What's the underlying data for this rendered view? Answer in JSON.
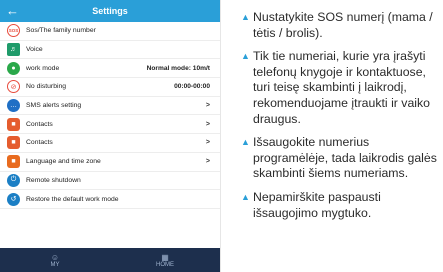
{
  "header": {
    "back_icon": "arrow-left-icon",
    "title": "Settings"
  },
  "settings": [
    {
      "name": "sos-family-number",
      "icon": "sos-icon",
      "icon_text": "SOS",
      "label": "Sos/The family number",
      "value": "",
      "chevron": ""
    },
    {
      "name": "voice",
      "icon": "trumpet-icon",
      "icon_text": "",
      "label": "Voice",
      "value": "",
      "chevron": ""
    },
    {
      "name": "work-mode",
      "icon": "work-mode-icon",
      "icon_text": "",
      "label": "work mode",
      "value": "Normal mode: 10m/t",
      "chevron": ""
    },
    {
      "name": "no-disturbing",
      "icon": "do-not-disturb-icon",
      "icon_text": "",
      "label": "No disturbing",
      "value": "00:00-00:00",
      "chevron": ""
    },
    {
      "name": "sms-alerts",
      "icon": "chat-bubble-icon",
      "icon_text": "",
      "label": "SMS alerts setting",
      "value": "",
      "chevron": ">"
    },
    {
      "name": "contacts-1",
      "icon": "contacts-icon",
      "icon_text": "",
      "label": "Contacts",
      "value": "",
      "chevron": ">"
    },
    {
      "name": "contacts-2",
      "icon": "contacts-icon",
      "icon_text": "",
      "label": "Contacts",
      "value": "",
      "chevron": ">"
    },
    {
      "name": "language-time-zone",
      "icon": "language-icon",
      "icon_text": "",
      "label": "Language and time zone",
      "value": "",
      "chevron": ">"
    },
    {
      "name": "remote-shutdown",
      "icon": "power-icon",
      "icon_text": "",
      "label": "Remote shutdown",
      "value": "",
      "chevron": ""
    },
    {
      "name": "restore-default",
      "icon": "restore-icon",
      "icon_text": "",
      "label": "Restore the default work mode",
      "value": "",
      "chevron": ""
    }
  ],
  "bottom_tabs": [
    {
      "name": "my",
      "icon": "person-icon",
      "label": "MY"
    },
    {
      "name": "home",
      "icon": "home-icon",
      "label": "HOME"
    }
  ],
  "notes": [
    "Nustatykite SOS numerį (mama / tėtis / brolis).",
    "Tik tie numeriai, kurie yra įrašyti telefonų knygoje ir kontaktuose, turi teisę skambinti į laikrodį, rekomenduojame įtraukti ir vaiko draugus.",
    "Išsaugokite numerius programėlėje, tada laikrodis galės skambinti šiems numeriams.",
    "Nepamirškite paspausti išsaugojimo mygtuko."
  ],
  "colors": {
    "accent": "#2a9fd8",
    "bottom_bar": "#1d2f4d",
    "note_bullet": "#2a9fd8"
  }
}
